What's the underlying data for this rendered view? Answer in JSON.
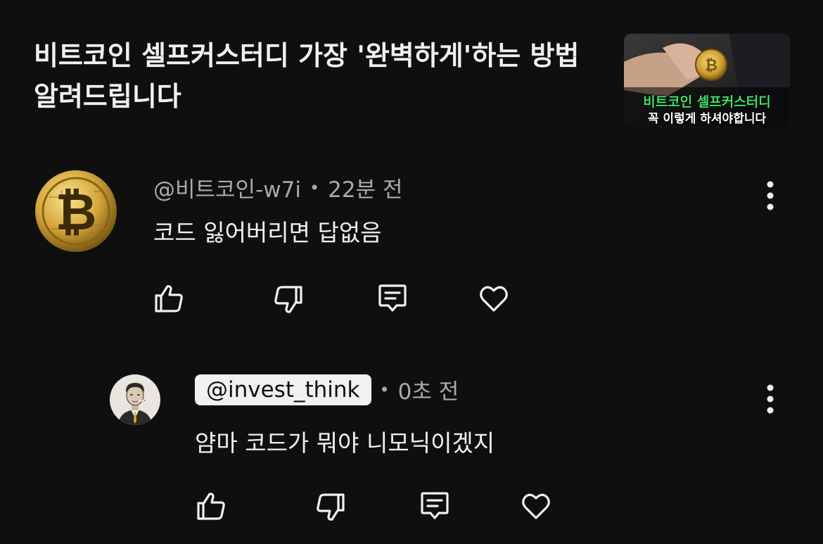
{
  "video": {
    "title": "비트코인 셀프커스터디 가장 '완벽하게'하는 방법 알려드립니다",
    "thumbnail_line1": "비트코인 셀프커스터디",
    "thumbnail_line2": "꼭 이렇게 하셔야합니다"
  },
  "comments": [
    {
      "handle": "@비트코인-w7i",
      "time": "22분 전",
      "text": "코드 잃어버리면 답없음",
      "avatar": "bitcoin-coin"
    },
    {
      "handle": "@invest_think",
      "time": "0초 전",
      "text": "얌마 코드가 뭐야 니모닉이겠지",
      "avatar": "man-portrait",
      "handle_highlighted": true
    }
  ],
  "separator": "•",
  "icons": {
    "like": "thumb-up-icon",
    "dislike": "thumb-down-icon",
    "reply": "comment-icon",
    "heart": "heart-icon",
    "menu": "kebab-menu-icon"
  },
  "colors": {
    "background": "#0f0f0f",
    "text": "#f1f1f1",
    "secondary_text": "#aaaaaa",
    "thumbnail_green": "#3ee06b"
  }
}
